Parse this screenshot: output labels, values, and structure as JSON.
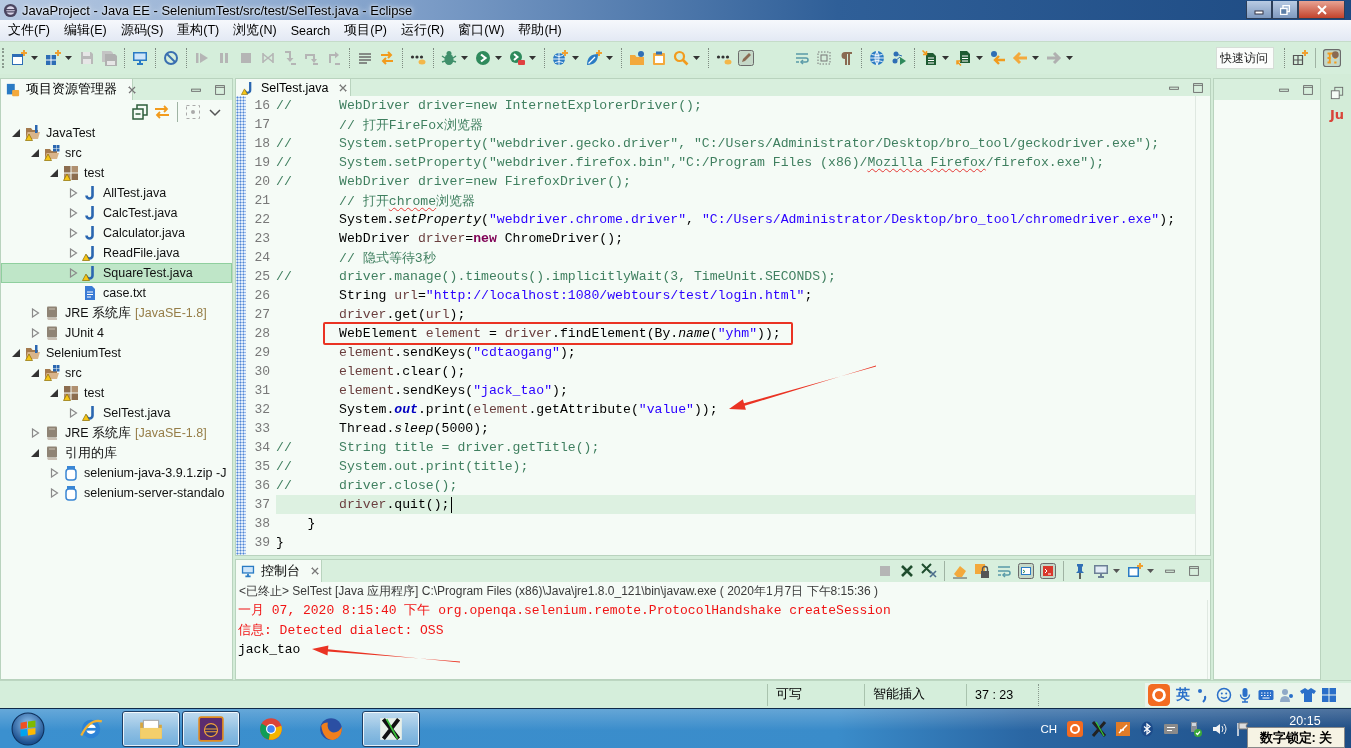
{
  "window": {
    "title": "JavaProject - Java EE - SeleniumTest/src/test/SelTest.java - Eclipse"
  },
  "menu": [
    "文件(F)",
    "编辑(E)",
    "源码(S)",
    "重构(T)",
    "浏览(N)",
    "Search",
    "项目(P)",
    "运行(R)",
    "窗口(W)",
    "帮助(H)"
  ],
  "quick_access": {
    "placeholder": "快速访问"
  },
  "explorer": {
    "title": "项目资源管理器",
    "tree": [
      {
        "label": "JavaTest",
        "kind": "project",
        "expanded": true,
        "warning": true,
        "selected": false,
        "children": [
          {
            "label": "src",
            "kind": "source_folder",
            "expanded": true,
            "warning": true,
            "selected": false,
            "children": [
              {
                "label": "test",
                "kind": "package",
                "expanded": true,
                "warning": true,
                "selected": false,
                "children": [
                  {
                    "label": "AllTest.java",
                    "kind": "java",
                    "expanded": false,
                    "warning": false,
                    "selected": false
                  },
                  {
                    "label": "CalcTest.java",
                    "kind": "java",
                    "expanded": false,
                    "warning": false,
                    "selected": false
                  },
                  {
                    "label": "Calculator.java",
                    "kind": "java",
                    "expanded": false,
                    "warning": false,
                    "selected": false
                  },
                  {
                    "label": "ReadFile.java",
                    "kind": "java",
                    "expanded": false,
                    "warning": true,
                    "selected": false
                  },
                  {
                    "label": "SquareTest.java",
                    "kind": "java",
                    "expanded": false,
                    "warning": true,
                    "selected": true
                  },
                  {
                    "label": "case.txt",
                    "kind": "text",
                    "warning": false,
                    "selected": false
                  }
                ]
              }
            ]
          },
          {
            "label": "JRE 系统库",
            "decoration": "[JavaSE-1.8]",
            "kind": "library",
            "expanded": false,
            "warning": false,
            "selected": false
          },
          {
            "label": "JUnit 4",
            "kind": "library",
            "expanded": false,
            "warning": false,
            "selected": false
          }
        ]
      },
      {
        "label": "SeleniumTest",
        "kind": "project",
        "expanded": true,
        "warning": true,
        "selected": false,
        "children": [
          {
            "label": "src",
            "kind": "source_folder",
            "expanded": true,
            "warning": true,
            "selected": false,
            "children": [
              {
                "label": "test",
                "kind": "package",
                "expanded": true,
                "warning": true,
                "selected": false,
                "children": [
                  {
                    "label": "SelTest.java",
                    "kind": "java",
                    "expanded": false,
                    "warning": true,
                    "selected": false
                  }
                ]
              }
            ]
          },
          {
            "label": "JRE 系统库",
            "decoration": "[JavaSE-1.8]",
            "kind": "library",
            "expanded": false,
            "warning": false,
            "selected": false
          },
          {
            "label": "引用的库",
            "kind": "library",
            "expanded": true,
            "warning": false,
            "selected": false,
            "children": [
              {
                "label": "selenium-java-3.9.1.zip -J",
                "kind": "jar",
                "expanded": false,
                "warning": false,
                "selected": false
              },
              {
                "label": "selenium-server-standalo",
                "kind": "jar",
                "expanded": false,
                "warning": false,
                "selected": false
              }
            ]
          }
        ]
      }
    ]
  },
  "editor": {
    "tab": {
      "label": "SelTest.java",
      "warning": true
    },
    "lines": [
      {
        "number": "16",
        "current": false,
        "outlined": false,
        "segments": [
          {
            "kind": "comment",
            "text": "//\t\tWebDriver driver=new InternetExplorerDriver();"
          }
        ]
      },
      {
        "number": "17",
        "current": false,
        "outlined": false,
        "segments": [
          {
            "kind": "comment",
            "text": "\t\t// 打开FireFox浏览器"
          }
        ]
      },
      {
        "number": "18",
        "current": false,
        "outlined": false,
        "segments": [
          {
            "kind": "comment",
            "text": "//\t\tSystem.setProperty(\"webdriver.gecko.driver\", \"C:/Users/Administrator/Desktop/bro_tool/geckodriver.exe\");"
          }
        ]
      },
      {
        "number": "19",
        "current": false,
        "outlined": false,
        "segments": [
          {
            "kind": "comment",
            "text": "//\t\tSystem.setProperty(\"webdriver.firefox.bin\",\"C:/Program Files (x86)/"
          },
          {
            "kind": "typo",
            "text": "Mozilla Firefox"
          },
          {
            "kind": "comment",
            "text": "/firefox.exe\");"
          }
        ]
      },
      {
        "number": "20",
        "current": false,
        "outlined": false,
        "segments": [
          {
            "kind": "comment",
            "text": "//\t\tWebDriver driver=new FirefoxDriver();"
          }
        ]
      },
      {
        "number": "21",
        "current": false,
        "outlined": false,
        "segments": [
          {
            "kind": "comment",
            "text": "\t\t// 打开"
          },
          {
            "kind": "typo",
            "text": "chrome"
          },
          {
            "kind": "comment",
            "text": "浏览器"
          }
        ]
      },
      {
        "number": "22",
        "current": false,
        "outlined": false,
        "segments": [
          {
            "kind": "plain",
            "text": "\t\tSystem."
          },
          {
            "kind": "static_method",
            "text": "setProperty"
          },
          {
            "kind": "plain",
            "text": "("
          },
          {
            "kind": "string",
            "text": "\"webdriver.chrome.driver\""
          },
          {
            "kind": "plain",
            "text": ", "
          },
          {
            "kind": "string",
            "text": "\"C:/Users/Administrator/Desktop/bro_tool/chromedriver.exe\""
          },
          {
            "kind": "plain",
            "text": ");"
          }
        ]
      },
      {
        "number": "23",
        "current": false,
        "outlined": false,
        "segments": [
          {
            "kind": "plain",
            "text": "\t\tWebDriver "
          },
          {
            "kind": "local",
            "text": "driver"
          },
          {
            "kind": "plain",
            "text": "="
          },
          {
            "kind": "keyword",
            "text": "new"
          },
          {
            "kind": "plain",
            "text": " ChromeDriver();"
          }
        ]
      },
      {
        "number": "24",
        "current": false,
        "outlined": false,
        "segments": [
          {
            "kind": "comment",
            "text": "\t\t// 隐式等待3秒"
          }
        ]
      },
      {
        "number": "25",
        "current": false,
        "outlined": false,
        "segments": [
          {
            "kind": "comment",
            "text": "//\t\tdriver.manage().timeouts().implicitlyWait(3, TimeUnit.SECONDS);"
          }
        ]
      },
      {
        "number": "26",
        "current": false,
        "outlined": false,
        "segments": [
          {
            "kind": "plain",
            "text": "\t\tString "
          },
          {
            "kind": "local",
            "text": "url"
          },
          {
            "kind": "plain",
            "text": "="
          },
          {
            "kind": "string",
            "text": "\"http://localhost:1080/webtours/test/login.html\""
          },
          {
            "kind": "plain",
            "text": ";"
          }
        ]
      },
      {
        "number": "27",
        "current": false,
        "outlined": false,
        "segments": [
          {
            "kind": "local",
            "text": "\t\tdriver"
          },
          {
            "kind": "plain",
            "text": ".get("
          },
          {
            "kind": "local",
            "text": "url"
          },
          {
            "kind": "plain",
            "text": ");"
          }
        ]
      },
      {
        "number": "28",
        "current": false,
        "outlined": true,
        "segments": [
          {
            "kind": "plain",
            "text": "\t\tWebElement "
          },
          {
            "kind": "local",
            "text": "element"
          },
          {
            "kind": "plain",
            "text": " = "
          },
          {
            "kind": "local",
            "text": "driver"
          },
          {
            "kind": "plain",
            "text": ".findElement(By."
          },
          {
            "kind": "static_method",
            "text": "name"
          },
          {
            "kind": "plain",
            "text": "("
          },
          {
            "kind": "string",
            "text": "\"yhm\""
          },
          {
            "kind": "plain",
            "text": "));"
          }
        ]
      },
      {
        "number": "29",
        "current": false,
        "outlined": false,
        "segments": [
          {
            "kind": "local",
            "text": "\t\telement"
          },
          {
            "kind": "plain",
            "text": ".sendKeys("
          },
          {
            "kind": "string",
            "text": "\"cdtaogang\""
          },
          {
            "kind": "plain",
            "text": ");"
          }
        ]
      },
      {
        "number": "30",
        "current": false,
        "outlined": false,
        "segments": [
          {
            "kind": "local",
            "text": "\t\telement"
          },
          {
            "kind": "plain",
            "text": ".clear();"
          }
        ]
      },
      {
        "number": "31",
        "current": false,
        "outlined": false,
        "segments": [
          {
            "kind": "local",
            "text": "\t\telement"
          },
          {
            "kind": "plain",
            "text": ".sendKeys("
          },
          {
            "kind": "string",
            "text": "\"jack_tao\""
          },
          {
            "kind": "plain",
            "text": ");"
          }
        ]
      },
      {
        "number": "32",
        "current": false,
        "outlined": false,
        "segments": [
          {
            "kind": "plain",
            "text": "\t\tSystem."
          },
          {
            "kind": "static_field",
            "text": "out"
          },
          {
            "kind": "plain",
            "text": ".print("
          },
          {
            "kind": "local",
            "text": "element"
          },
          {
            "kind": "plain",
            "text": ".getAttribute("
          },
          {
            "kind": "string",
            "text": "\"value\""
          },
          {
            "kind": "plain",
            "text": "));"
          }
        ]
      },
      {
        "number": "33",
        "current": false,
        "outlined": false,
        "segments": [
          {
            "kind": "plain",
            "text": "\t\tThread."
          },
          {
            "kind": "static_method",
            "text": "sleep"
          },
          {
            "kind": "plain",
            "text": "(5000);"
          }
        ]
      },
      {
        "number": "34",
        "current": false,
        "outlined": false,
        "segments": [
          {
            "kind": "comment",
            "text": "//\t\tString title = driver.getTitle();"
          }
        ]
      },
      {
        "number": "35",
        "current": false,
        "outlined": false,
        "segments": [
          {
            "kind": "comment",
            "text": "//\t\tSystem.out.print(title);"
          }
        ]
      },
      {
        "number": "36",
        "current": false,
        "outlined": false,
        "segments": [
          {
            "kind": "comment",
            "text": "//\t\tdriver.close();"
          }
        ]
      },
      {
        "number": "37",
        "current": true,
        "outlined": false,
        "segments": [
          {
            "kind": "local",
            "text": "\t\tdriver"
          },
          {
            "kind": "plain",
            "text": ".quit();"
          }
        ]
      },
      {
        "number": "38",
        "current": false,
        "outlined": false,
        "segments": [
          {
            "kind": "plain",
            "text": "\t}"
          }
        ]
      },
      {
        "number": "39",
        "current": false,
        "outlined": false,
        "segments": [
          {
            "kind": "plain",
            "text": "}"
          }
        ]
      }
    ]
  },
  "side_trim": {
    "view_label": "Ju"
  },
  "console": {
    "title": "控制台",
    "process": "<已终止> SelTest [Java 应用程序] C:\\Program Files (x86)\\Java\\jre1.8.0_121\\bin\\javaw.exe ( 2020年1月7日 下午8:15:36 )",
    "output": [
      {
        "kind": "error",
        "text": "一月 07, 2020 8:15:40 下午 org.openqa.selenium.remote.ProtocolHandshake createSession"
      },
      {
        "kind": "error",
        "text": "信息: Detected dialect: OSS"
      },
      {
        "kind": "output",
        "text": "jack_tao"
      }
    ]
  },
  "status_bar": [
    "可写",
    "智能插入",
    "37 : 23"
  ],
  "ime_bar": {
    "mode": "英"
  },
  "taskbar": {
    "apps": [
      {
        "kind": "globe_e",
        "running": false
      },
      {
        "kind": "folders",
        "running": true
      },
      {
        "kind": "ide",
        "running": true
      },
      {
        "kind": "round_browser",
        "running": false
      },
      {
        "kind": "fox_browser",
        "running": false
      },
      {
        "kind": "cross_app",
        "running": true
      }
    ],
    "language": "CH",
    "clock": "20:15",
    "tooltip": "数字锁定: 关"
  }
}
